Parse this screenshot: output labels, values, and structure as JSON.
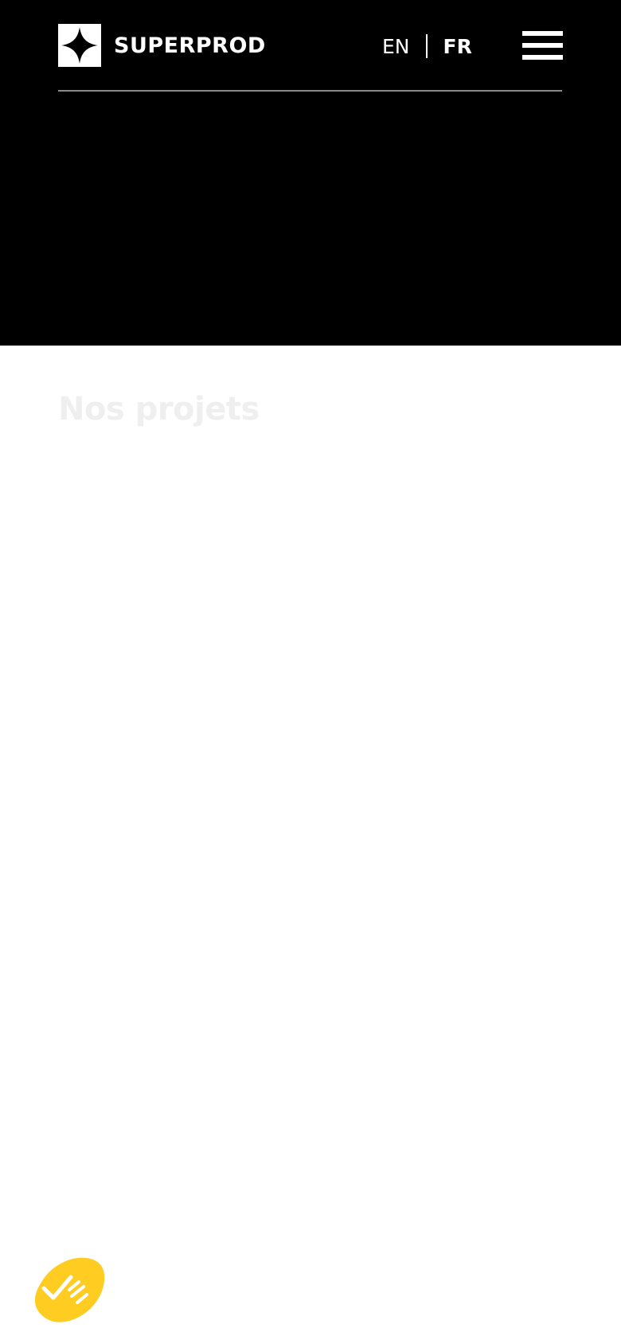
{
  "header": {
    "brand_name": "SUPERPROD",
    "languages": [
      {
        "code": "EN",
        "active": false
      },
      {
        "code": "FR",
        "active": true
      }
    ],
    "menu_icon": "hamburger-menu-icon"
  },
  "main": {
    "section_title": "Nos projets"
  },
  "consent_widget": {
    "icon": "checkmark-icon",
    "color": "#FFCC22"
  },
  "colors": {
    "hero_background": "#000000",
    "page_background": "#FFFFFF",
    "title_color": "#EFEFEF",
    "accent": "#FFCC22"
  }
}
